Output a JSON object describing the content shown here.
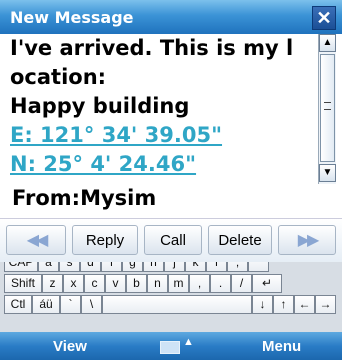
{
  "window": {
    "title": "New Message",
    "close_label": "✕"
  },
  "message": {
    "lines": [
      "I've arrived. This is my l",
      "ocation:",
      "Happy building"
    ],
    "coords": [
      "E: 121° 34' 39.05\"",
      "N: 25° 4' 24.46\""
    ]
  },
  "scrollbar": {
    "up": "▲",
    "down": "▼"
  },
  "sender": {
    "label": "From:Mysim"
  },
  "buttons": {
    "prev": "◀◀",
    "reply": "Reply",
    "call": "Call",
    "delete": "Delete",
    "next": "▶▶"
  },
  "keyboard": {
    "row1": [
      "CAP",
      "a",
      "s",
      "d",
      "f",
      "g",
      "h",
      "j",
      "k",
      "l",
      ";",
      "'"
    ],
    "row2": [
      "Shift",
      "z",
      "x",
      "c",
      "v",
      "b",
      "n",
      "m",
      ",",
      ".",
      "/",
      "↵"
    ],
    "row3": [
      "Ctl",
      "áü",
      "`",
      "\\",
      "",
      "↓",
      "↑",
      "←",
      "→"
    ]
  },
  "menubar": {
    "left": "View",
    "right": "Menu",
    "caret": "▲"
  }
}
